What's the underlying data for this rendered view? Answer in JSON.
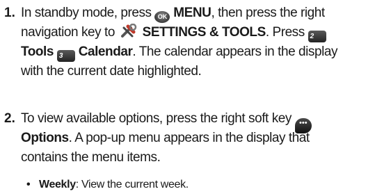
{
  "steps": [
    {
      "number": "1.",
      "lines": [
        {
          "a": "In standby mode, press ",
          "ok": "OK",
          "b": " ",
          "menu": "MENU",
          "c": ", then press the right"
        },
        {
          "a": "navigation key to ",
          "settings": "SETTINGS & TOOLS",
          "b": ". Press"
        },
        {
          "tools": "Tools",
          "cal": "Calendar",
          "a": ". The calendar appears in the display"
        },
        {
          "a": "with the current date highlighted."
        }
      ],
      "key2_label": "2",
      "key3_label": "3"
    },
    {
      "number": "2.",
      "lines": [
        {
          "a": "To view available options, press the right soft key"
        },
        {
          "options": "Options",
          "a": ". A pop-up menu appears in the display that"
        },
        {
          "a": "contains the menu items."
        }
      ],
      "soft_key_glyph": "•••"
    }
  ],
  "bullets": [
    {
      "term": "Weekly",
      "desc": ": View the current week."
    }
  ],
  "icons": [
    "ok-key-icon",
    "settings-tools-icon",
    "key-2-icon",
    "key-3-icon",
    "right-soft-key-icon"
  ]
}
